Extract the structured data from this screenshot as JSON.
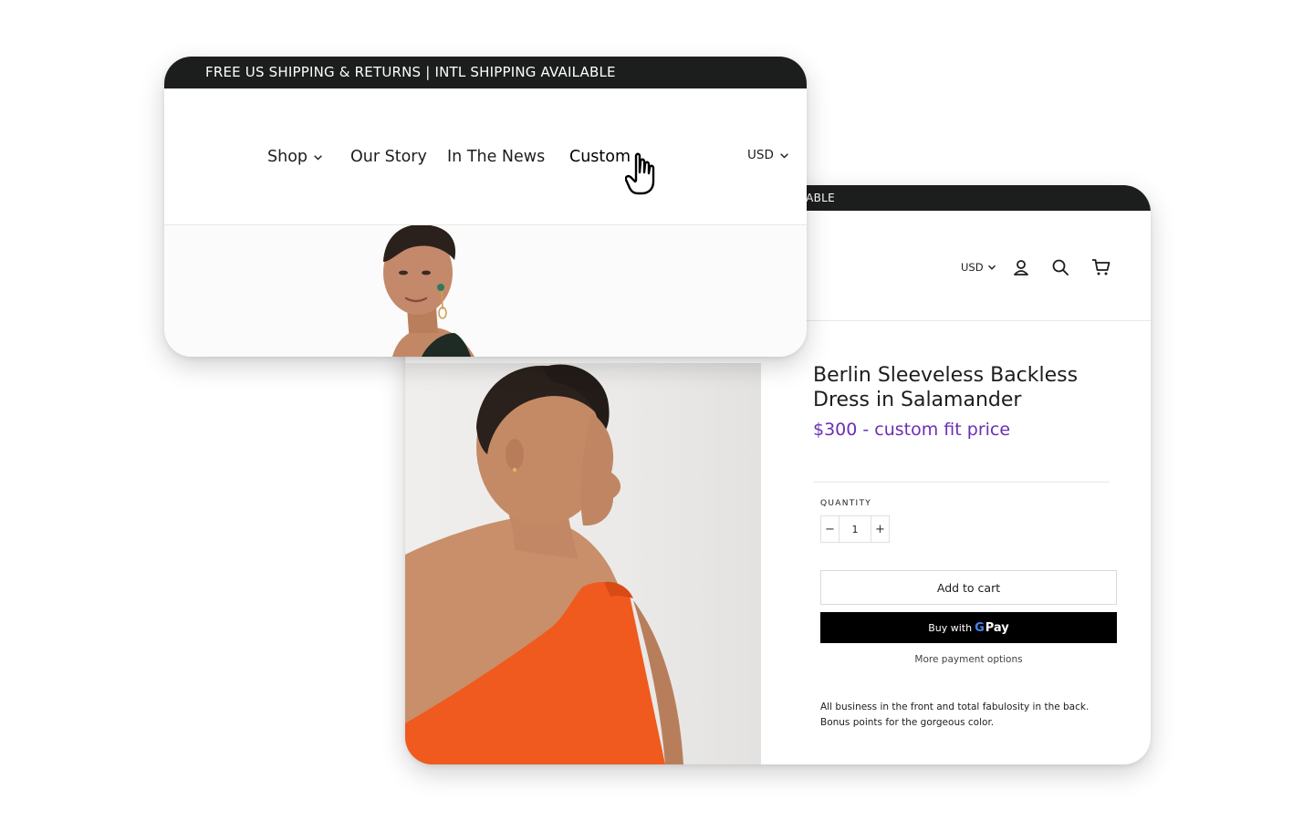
{
  "nav_card": {
    "announcement": "FREE US SHIPPING & RETURNS | INTL SHIPPING AVAILABLE",
    "menu": [
      {
        "label": "Shop",
        "has_dropdown": true
      },
      {
        "label": "Our Story"
      },
      {
        "label": "In The News"
      },
      {
        "label": "Custom"
      }
    ],
    "currency": "USD"
  },
  "product_card": {
    "announcement_visible": "ILABLE",
    "currency": "USD",
    "icons": [
      "user-icon",
      "search-icon",
      "cart-icon"
    ],
    "product": {
      "title": "Berlin Sleeveless Backless Dress in Salamander",
      "price": "$300 - custom fit price",
      "quantity_label": "QUANTITY",
      "quantity": "1",
      "minus": "−",
      "plus": "+",
      "add_to_cart": "Add to cart",
      "buy_with": "Buy with",
      "gpay_g": "G",
      "gpay_pay": "Pay",
      "more_payment_options": "More payment options",
      "description": "All business in the front and total fabulosity in the back. Bonus points for the gorgeous color."
    }
  },
  "colors": {
    "announcement_bg": "#1c1d1d",
    "price": "#6b2fb3",
    "dress": "#f05a1e",
    "buy_button": "#000000"
  }
}
